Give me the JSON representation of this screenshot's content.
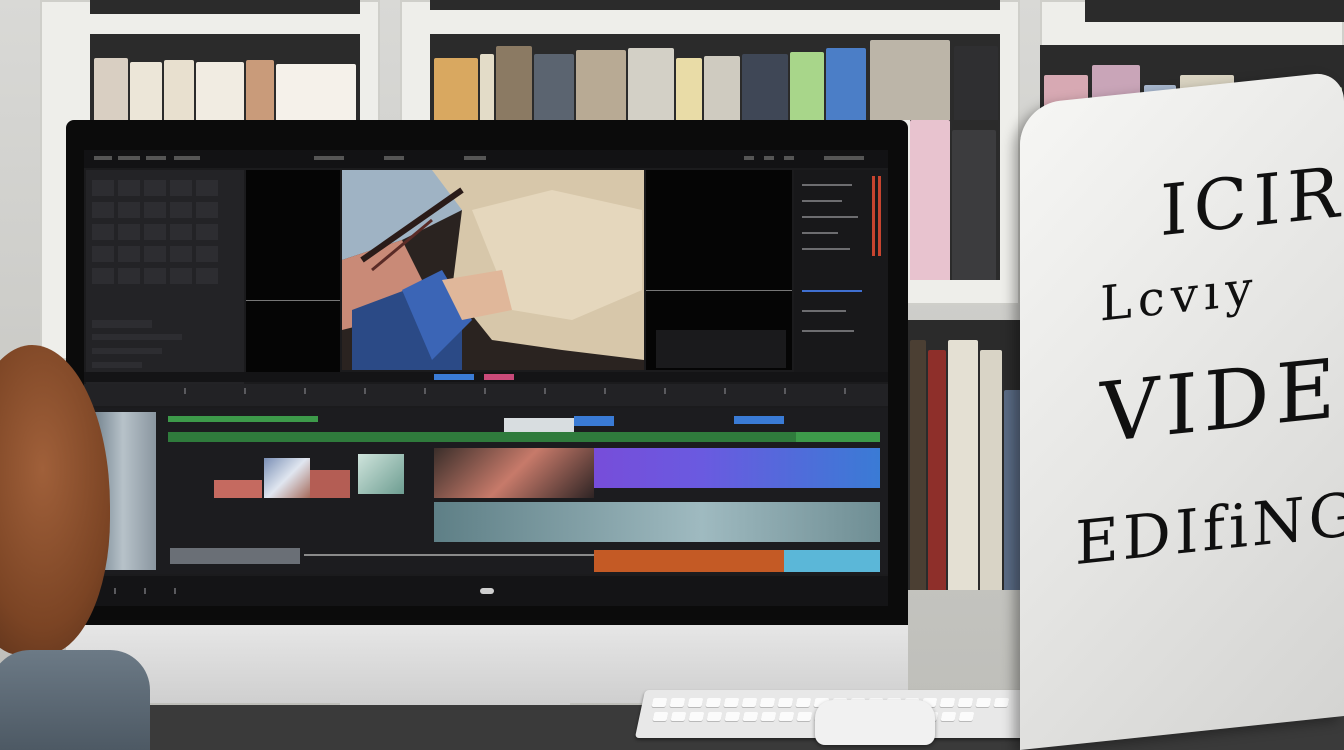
{
  "scene": {
    "description_tags": [
      "video-editing-workstation",
      "bookshelf",
      "handwritten-sign"
    ]
  },
  "poster": {
    "line1": "ICIR",
    "line2": "Lcvıy",
    "line3": "VIDEU",
    "line4": "EDIfiNG"
  },
  "colors": {
    "timeline_green": "#3d9a4a",
    "timeline_purple": "#7a4ad8",
    "timeline_blue": "#3a7bd5",
    "timeline_orange": "#c45a25",
    "timeline_cyan": "#5bb7d8"
  }
}
